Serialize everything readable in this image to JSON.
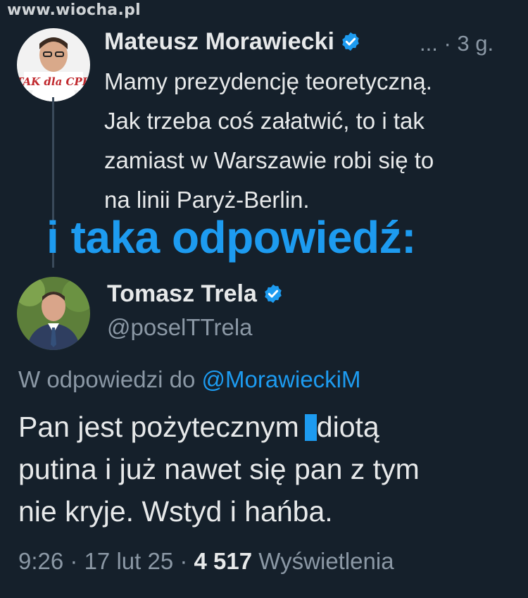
{
  "watermark": "www.wiocha.pl",
  "tweet1": {
    "author_name": "Mateusz Morawiecki",
    "more": "...",
    "separator": "·",
    "time_ago": "3 g.",
    "avatar_sign": "TAK dla CPK",
    "lines": [
      "Mamy prezydencję teoretyczną.",
      "Jak trzeba coś załatwić, to i tak",
      "zamiast w Warszawie robi się to",
      "na linii Paryż-Berlin."
    ]
  },
  "overlay_caption": "i taka odpowiedź:",
  "tweet2": {
    "author_name": "Tomasz Trela",
    "handle": "@poselTTrela",
    "reply_prefix": "W odpowiedzi do",
    "reply_mention": "@MorawieckiM",
    "line1_before": "Pan jest pożytecznym",
    "line1_after": "diotą",
    "line2": "putina i już nawet się pan z tym",
    "line3": "nie kryje. Wstyd i hańba.",
    "time": "9:26",
    "date": "17 lut 25",
    "views_count": "4 517",
    "views_label": "Wyświetlenia",
    "separator": "·"
  },
  "colors": {
    "background": "#15202b",
    "accent": "#1d9bf0",
    "text": "#e7e9ea",
    "muted": "#8b98a5"
  },
  "icons": [
    "verified-badge-icon"
  ]
}
